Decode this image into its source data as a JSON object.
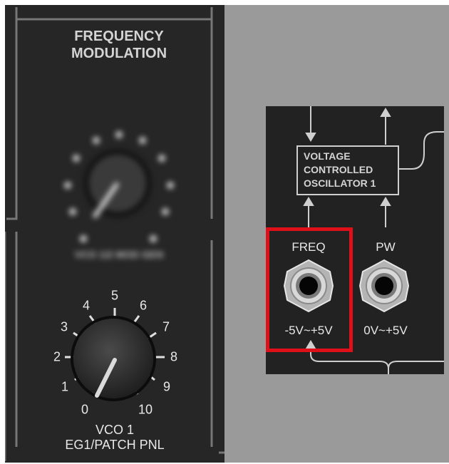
{
  "fm_section": {
    "title_line1": "FREQUENCY",
    "title_line2": "MODULATION",
    "blurred_knob_label": "VCO 1/2 MOD GEN"
  },
  "vco1_knob": {
    "ticks": [
      "0",
      "1",
      "2",
      "3",
      "4",
      "5",
      "6",
      "7",
      "8",
      "9",
      "10"
    ],
    "label_line1": "VCO 1",
    "label_line2": "EG1/PATCH PNL"
  },
  "vco_module": {
    "title_line1": "VOLTAGE",
    "title_line2": "CONTROLLED",
    "title_line3": "OSCILLATOR 1"
  },
  "jacks": [
    {
      "name": "FREQ",
      "range": "-5V~+5V",
      "highlighted": true
    },
    {
      "name": "PW",
      "range": "0V~+5V",
      "highlighted": false
    }
  ],
  "colors": {
    "panel": "#262626",
    "highlight": "#e0101a",
    "background": "#9a9a9a"
  }
}
